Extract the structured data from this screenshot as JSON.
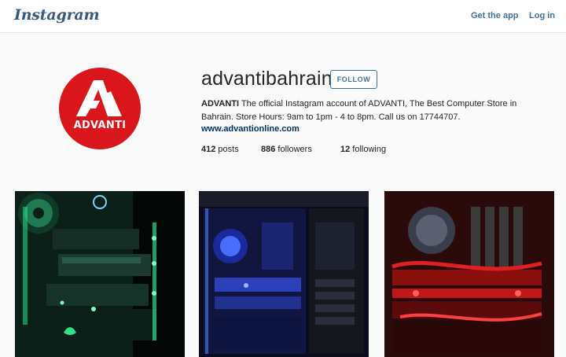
{
  "topbar": {
    "logo": "Instagram",
    "get_app": "Get the app",
    "login": "Log in"
  },
  "profile": {
    "avatar_text": "ADVANTI",
    "username": "advantibahrain",
    "follow_label": "FOLLOW",
    "bio_name": "ADVANTI",
    "bio_line1": " The official Instagram account of ADVANTI, The Best Computer Store in",
    "bio_line2": "Bahrain. Store Hours: 9am to 1pm - 4 to 8pm. Call us on 17744707.",
    "website": "www.advantionline.com",
    "stats": {
      "posts_count": "412",
      "posts_label": " posts",
      "followers_count": "886",
      "followers_label": " followers",
      "following_count": "12",
      "following_label": " following"
    }
  },
  "grid": {
    "photos": [
      {
        "subject": "green-lit pc build",
        "accent": "#2de08a"
      },
      {
        "subject": "blue-lit pc build",
        "accent": "#4a6dff"
      },
      {
        "subject": "red-lit pc build",
        "accent": "#e02020"
      }
    ]
  },
  "colors": {
    "link": "#3f729b",
    "avatar_bg": "#d8161b",
    "website": "#003569"
  }
}
